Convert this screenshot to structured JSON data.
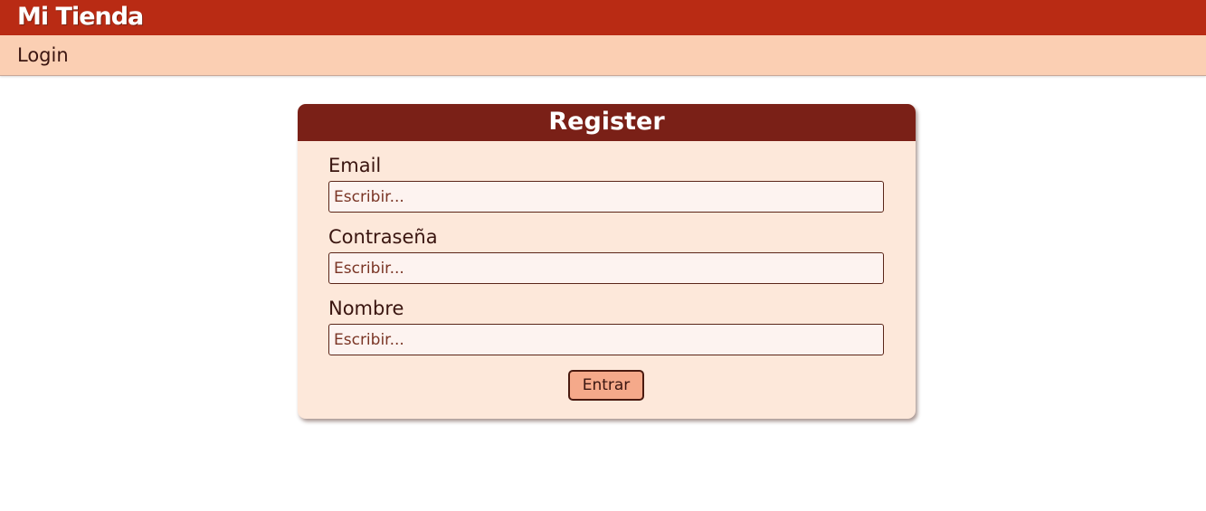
{
  "header": {
    "brand": "Mi Tienda",
    "nav_login": "Login"
  },
  "form": {
    "title": "Register",
    "fields": [
      {
        "label": "Email",
        "placeholder": "Escribir...",
        "value": ""
      },
      {
        "label": "Contraseña",
        "placeholder": "Escribir...",
        "value": ""
      },
      {
        "label": "Nombre",
        "placeholder": "Escribir...",
        "value": ""
      }
    ],
    "submit_label": "Entrar"
  },
  "colors": {
    "topbar": "#b92b14",
    "navbar": "#fbcfb3",
    "card_header": "#7a2017",
    "card_body": "#fde8da",
    "button": "#f5a98a"
  }
}
